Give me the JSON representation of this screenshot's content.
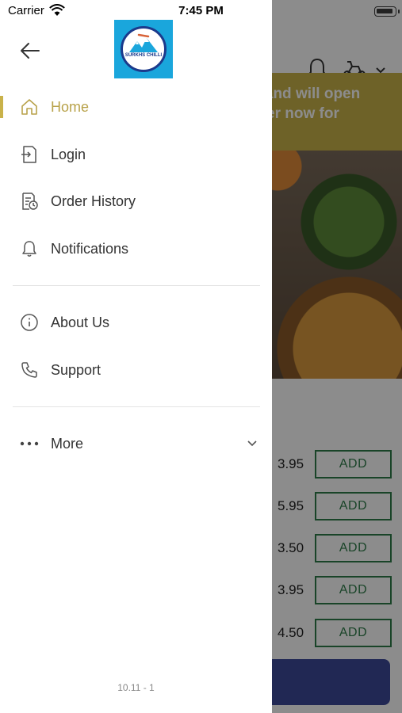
{
  "status_bar": {
    "carrier": "Carrier",
    "time": "7:45 PM"
  },
  "background": {
    "banner_text": "d and will open rder now for",
    "items": [
      {
        "price": "3.95",
        "add_label": "ADD"
      },
      {
        "price": "5.95",
        "add_label": "ADD"
      },
      {
        "price": "3.50",
        "add_label": "ADD"
      },
      {
        "price": "3.95",
        "add_label": "ADD"
      },
      {
        "price": "4.50",
        "add_label": "ADD"
      }
    ]
  },
  "drawer": {
    "logo_text": "SURKHS CHILLI",
    "menu": {
      "home": "Home",
      "login": "Login",
      "order_history": "Order History",
      "notifications": "Notifications",
      "about_us": "About Us",
      "support": "Support",
      "more": "More"
    },
    "version": "10.11 - 1",
    "accent_color": "#c9b24a"
  }
}
